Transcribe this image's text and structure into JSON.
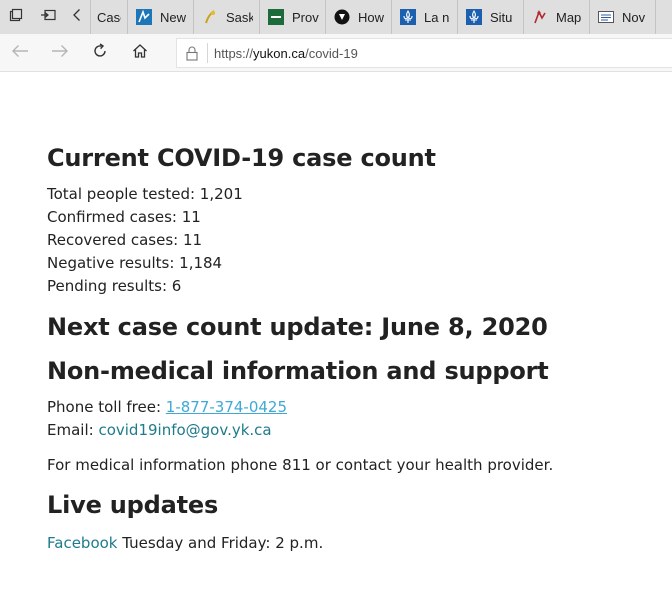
{
  "tabs": [
    {
      "label": "Case",
      "icon": "document-icon"
    },
    {
      "label": "New",
      "icon": "site-favicon-icon"
    },
    {
      "label": "Sask",
      "icon": "saskatchewan-favicon-icon"
    },
    {
      "label": "Prov",
      "icon": "ontario-favicon-icon"
    },
    {
      "label": "How",
      "icon": "shield-favicon-icon"
    },
    {
      "label": "La n",
      "icon": "quebec-fleur-de-lis-icon"
    },
    {
      "label": "Situ",
      "icon": "quebec-fleur-de-lis-icon"
    },
    {
      "label": "Map",
      "icon": "map-favicon-icon"
    },
    {
      "label": "Nov",
      "icon": "news-favicon-icon"
    }
  ],
  "address_bar": {
    "url_prefix": "https://",
    "url_host": "yukon.ca",
    "url_path": "/covid-19"
  },
  "page": {
    "case_count_heading": "Current COVID-19 case count",
    "stats": [
      "Total people tested: 1,201",
      "Confirmed cases: 11",
      "Recovered cases: 11",
      "Negative results: 1,184",
      "Pending results: 6"
    ],
    "next_update_heading": "Next case count update: June 8, 2020",
    "nonmedical_heading": "Non-medical information and support",
    "phone_label": "Phone toll free: ",
    "phone_number": "1-877-374-0425",
    "email_label": "Email: ",
    "email_address": "covid19info@gov.yk.ca",
    "medical_note": "For medical information phone 811 or contact your health provider.",
    "live_updates_heading": "Live updates",
    "facebook_link": "Facebook",
    "facebook_schedule": " Tuesday and Friday: 2 p.m."
  },
  "colors": {
    "link": "#1e7b8c",
    "phone_link": "#3fa9d6",
    "tabstrip_bg": "#dfdfdf"
  }
}
